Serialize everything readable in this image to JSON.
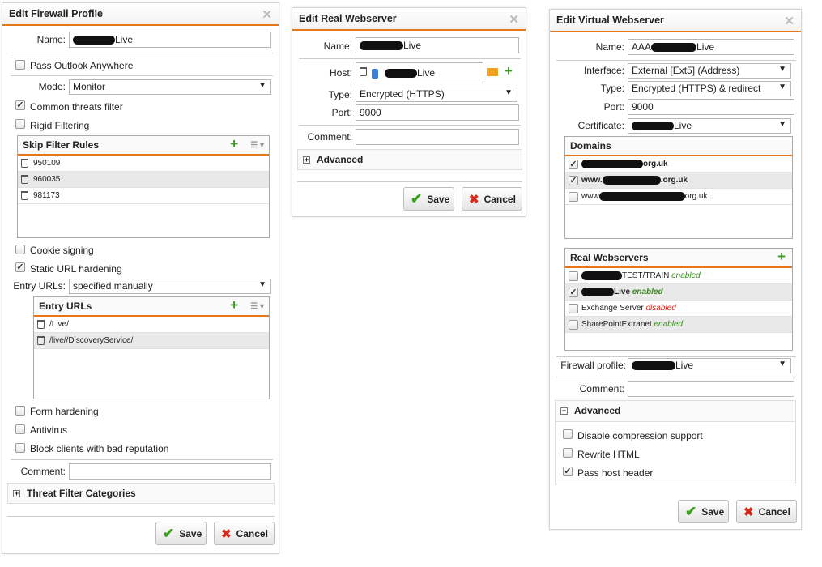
{
  "fw": {
    "title": "Edit Firewall Profile",
    "name_label": "Name:",
    "name_value": "Live",
    "pass_outlook": "Pass Outlook Anywhere",
    "mode_label": "Mode:",
    "mode_value": "Monitor",
    "common_threats": "Common threats filter",
    "rigid": "Rigid Filtering",
    "skip_title": "Skip Filter Rules",
    "skip_rules": [
      "950109",
      "960035",
      "981173"
    ],
    "cookie": "Cookie signing",
    "static_url": "Static URL hardening",
    "entry_label": "Entry URLs:",
    "entry_value": "specified manually",
    "entry_title": "Entry URLs",
    "entry_urls": [
      "/Live/",
      "/live//DiscoveryService/"
    ],
    "form": "Form hardening",
    "antivirus": "Antivirus",
    "block": "Block clients with bad reputation",
    "comment_label": "Comment:",
    "threat_cats": "Threat Filter Categories",
    "save": "Save",
    "cancel": "Cancel"
  },
  "rw": {
    "title": "Edit Real Webserver",
    "name_label": "Name:",
    "name_value": "Live",
    "host_label": "Host:",
    "host_value": "Live",
    "type_label": "Type:",
    "type_value": "Encrypted (HTTPS)",
    "port_label": "Port:",
    "port_value": "9000",
    "comment_label": "Comment:",
    "advanced": "Advanced",
    "save": "Save",
    "cancel": "Cancel"
  },
  "vw": {
    "title": "Edit Virtual Webserver",
    "name_label": "Name:",
    "name_prefix": "AAA",
    "name_suffix": "Live",
    "iface_label": "Interface:",
    "iface_value": "External [Ext5] (Address)",
    "type_label": "Type:",
    "type_value": "Encrypted (HTTPS) & redirect",
    "port_label": "Port:",
    "port_value": "9000",
    "cert_label": "Certificate:",
    "cert_value": "Live",
    "domains_title": "Domains",
    "domains": [
      {
        "prefix": "",
        "suffix": "org.uk",
        "checked": true,
        "bold": true
      },
      {
        "prefix": "www.",
        "suffix": ".org.uk",
        "checked": true,
        "bold": true
      },
      {
        "prefix": "www",
        "suffix": "org.uk",
        "checked": false,
        "bold": false
      }
    ],
    "real_title": "Real Webservers",
    "real": [
      {
        "name": "TEST/TRAIN",
        "status": "enabled",
        "checked": false
      },
      {
        "name": "Live",
        "status": "enabled",
        "checked": true
      },
      {
        "name": "Exchange Server",
        "status": "disabled",
        "checked": false
      },
      {
        "name": "SharePointExtranet",
        "status": "enabled",
        "checked": false
      }
    ],
    "fw_label": "Firewall profile:",
    "fw_value": "Live",
    "comment_label": "Comment:",
    "advanced": "Advanced",
    "disable_comp": "Disable compression support",
    "rewrite": "Rewrite HTML",
    "pass_host": "Pass host header",
    "save": "Save",
    "cancel": "Cancel"
  }
}
